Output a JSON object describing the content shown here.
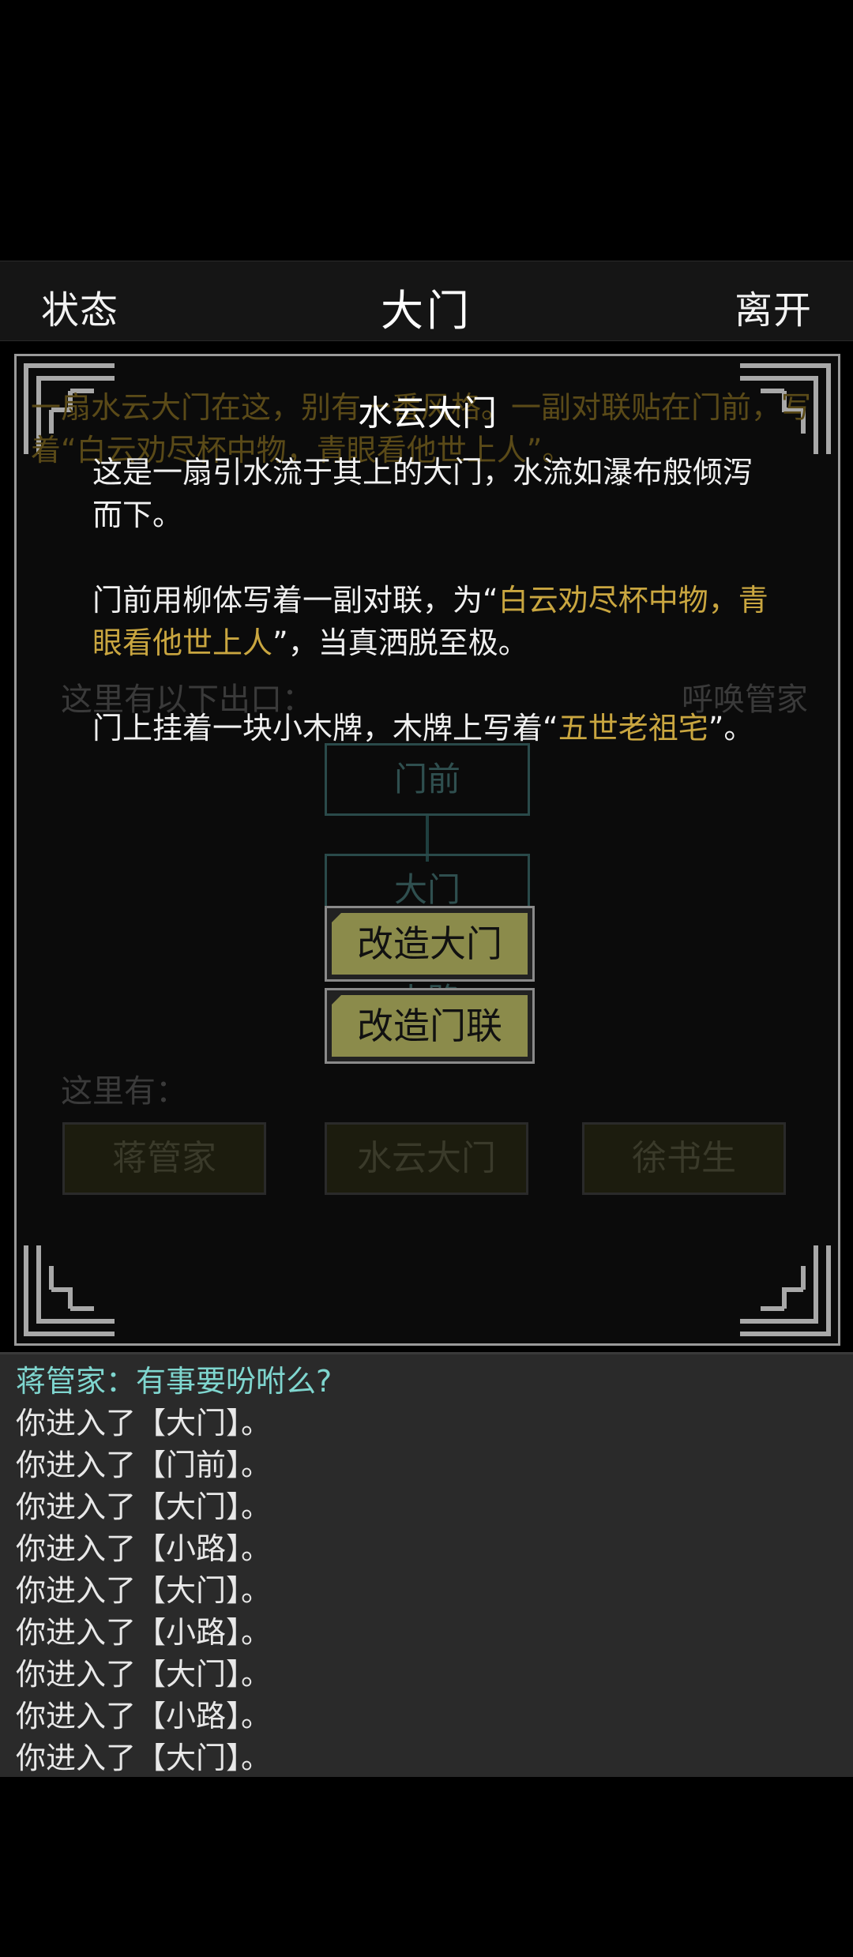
{
  "header": {
    "left_button": "状态",
    "title": "大门",
    "right_button": "离开"
  },
  "room": {
    "description": "一扇水云大门在这，别有一番风格。一副对联贴在门前，写着“白云劝尽杯中物，青眼看他世上人”。",
    "exits_label": "这里有以下出口：",
    "summon_label": "呼唤管家",
    "map": {
      "north": "门前",
      "current": "大门",
      "south": "小路"
    },
    "here_label": "这里有：",
    "npcs": [
      "蒋管家",
      "水云大门",
      "徐书生"
    ]
  },
  "modal": {
    "title": "水云大门",
    "para1": "这是一扇引水流于其上的大门，水流如瀑布般倾泻而下。",
    "para2_a": "门前用柳体写着一副对联，为“",
    "para2_hl": "白云劝尽杯中物，青眼看他世上人",
    "para2_b": "”，当真洒脱至极。",
    "para3_a": "门上挂着一块小木牌，木牌上写着“",
    "para3_hl": "五世老祖宅",
    "para3_b": "”。",
    "actions": [
      "改造大门",
      "改造门联"
    ]
  },
  "log": [
    "蒋管家：有事要吩咐么?",
    "你进入了【大门】。",
    "你进入了【门前】。",
    "你进入了【大门】。",
    "你进入了【小路】。",
    "你进入了【大门】。",
    "你进入了【小路】。",
    "你进入了【大门】。",
    "你进入了【小路】。",
    "你进入了【大门】。"
  ],
  "colors": {
    "highlight": "#c9a640",
    "npc_speech": "#7fd6cf",
    "button_fill": "#8b8b4b"
  }
}
